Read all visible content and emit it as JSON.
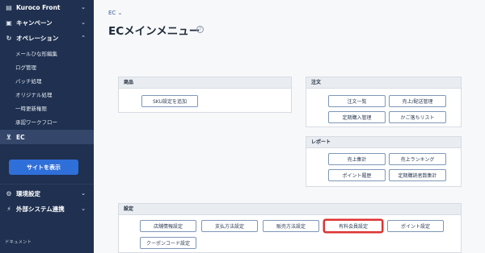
{
  "sidebar": {
    "items": [
      {
        "label": "Kuroco Front",
        "icon": "file-icon",
        "chevron": "⌄"
      },
      {
        "label": "キャンペーン",
        "icon": "gift-icon",
        "chevron": "⌄"
      },
      {
        "label": "オペレーション",
        "icon": "refresh-icon",
        "chevron": "⌃"
      }
    ],
    "sub_items": [
      "メールひな形編集",
      "ログ管理",
      "バッチ処理",
      "オリジナル処理",
      "一時更新権限",
      "承認ワークフロー"
    ],
    "ec": {
      "label": "EC",
      "icon": "cart-icon"
    },
    "view_site": "サイトを表示",
    "bottom_items": [
      {
        "label": "環境設定",
        "icon": "gear-icon",
        "chevron": "⌄"
      },
      {
        "label": "外部システム連携",
        "icon": "plug-icon",
        "chevron": "⌄"
      }
    ],
    "doc_label": "ドキュメント"
  },
  "header": {
    "breadcrumb": "EC ⌄",
    "title": "ECメインメニュー",
    "help": "?"
  },
  "panels": {
    "products": {
      "title": "商品",
      "buttons": [
        "SKU設定を追加"
      ]
    },
    "orders": {
      "title": "注文",
      "buttons": [
        "注文一覧",
        "売上/配送管理",
        "定期購入管理",
        "かご落ちリスト"
      ]
    },
    "reports": {
      "title": "レポート",
      "buttons": [
        "売上集計",
        "売上ランキング",
        "ポイント履歴",
        "定期購読者数集計"
      ]
    },
    "settings": {
      "title": "設定",
      "buttons": [
        "店舗情報設定",
        "支払方法設定",
        "販売方法設定",
        "有料会員設定",
        "ポイント設定",
        "クーポンコード設定"
      ]
    }
  },
  "colors": {
    "sidebar": "#1f3050",
    "accent": "#2f6fd9",
    "highlight": "#dd3333"
  }
}
